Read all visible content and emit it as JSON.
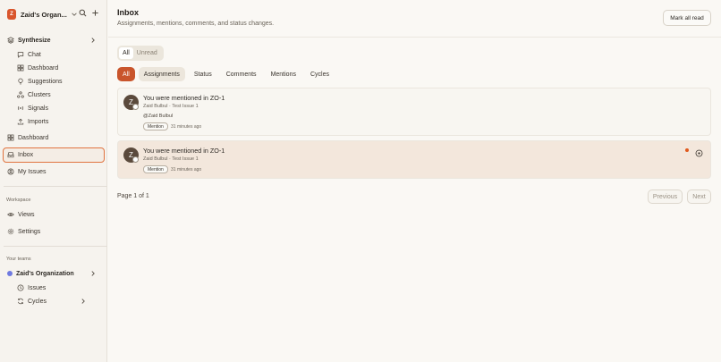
{
  "sidebar": {
    "org_badge": "Z",
    "org_name": "Zaid's Organ...",
    "synthesize": {
      "label": "Synthesize",
      "items": [
        {
          "label": "Chat",
          "icon": "chat-icon"
        },
        {
          "label": "Dashboard",
          "icon": "dashboard-icon"
        },
        {
          "label": "Suggestions",
          "icon": "lightbulb-icon"
        },
        {
          "label": "Clusters",
          "icon": "clusters-icon"
        },
        {
          "label": "Signals",
          "icon": "signals-icon"
        },
        {
          "label": "Imports",
          "icon": "upload-icon"
        }
      ]
    },
    "main_items": [
      {
        "label": "Dashboard",
        "icon": "dashboard-icon"
      },
      {
        "label": "Inbox",
        "icon": "inbox-icon"
      },
      {
        "label": "My Issues",
        "icon": "user-circle-icon"
      }
    ],
    "workspace": {
      "label": "Workspace",
      "items": [
        {
          "label": "Views",
          "icon": "eye-icon"
        },
        {
          "label": "Settings",
          "icon": "gear-icon"
        }
      ]
    },
    "teams": {
      "label": "Your teams",
      "team_name": "Zaid's Organization",
      "team_color": "#6f7ae0",
      "items": [
        {
          "label": "Issues",
          "icon": "issues-icon"
        },
        {
          "label": "Cycles",
          "icon": "cycles-icon"
        }
      ]
    }
  },
  "main": {
    "title": "Inbox",
    "subtitle": "Assignments, mentions, comments, and status changes.",
    "mark_all_read": "Mark all read",
    "segment": [
      "All",
      "Unread"
    ],
    "filters": [
      "All",
      "Assignments",
      "Status",
      "Comments",
      "Mentions",
      "Cycles"
    ],
    "notifications": [
      {
        "avatar": "Z",
        "title": "You were mentioned in ZO-1",
        "meta": "Zaid Bulbul · Test Issue 1",
        "mention_text": "@Zaid Bulbul",
        "tag": "Mention",
        "time": "31 minutes ago",
        "unread": false
      },
      {
        "avatar": "Z",
        "title": "You were mentioned in ZO-1",
        "meta": "Zaid Bulbul · Test Issue 1",
        "tag": "Mention",
        "time": "31 minutes ago",
        "unread": true
      }
    ],
    "pagination": {
      "text": "Page 1 of 1",
      "previous": "Previous",
      "next": "Next"
    }
  },
  "colors": {
    "accent": "#c9552c",
    "active_border": "#e0733f",
    "unread_dot": "#e05a1e"
  }
}
